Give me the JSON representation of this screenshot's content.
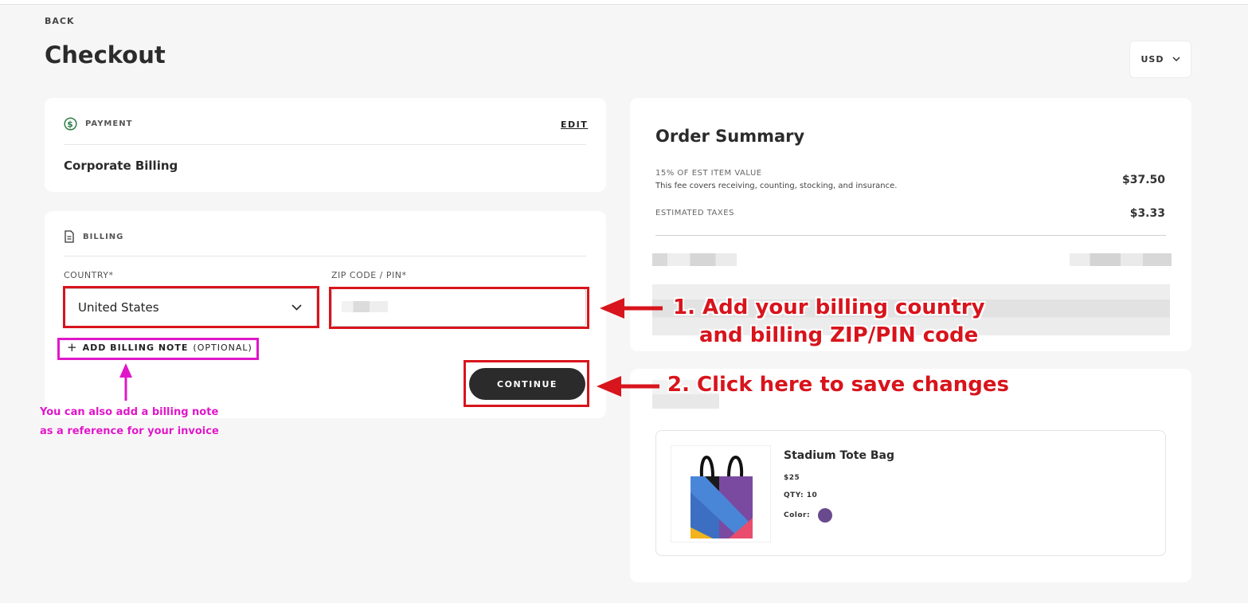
{
  "header": {
    "back_label": "BACK",
    "page_title": "Checkout",
    "currency": "USD"
  },
  "payment": {
    "section_label": "PAYMENT",
    "edit_label": "EDIT",
    "method": "Corporate Billing"
  },
  "billing": {
    "section_label": "BILLING",
    "country_label": "COUNTRY*",
    "country_value": "United States",
    "zip_label": "ZIP CODE / PIN*",
    "add_note_label": "ADD BILLING NOTE",
    "add_note_optional": "(OPTIONAL)",
    "continue_label": "CONTINUE"
  },
  "summary": {
    "title": "Order Summary",
    "fee_label": "15% OF EST ITEM VALUE",
    "fee_desc": "This fee covers receiving, counting, stocking, and insurance.",
    "fee_value": "$37.50",
    "tax_label": "ESTIMATED TAXES",
    "tax_value": "$3.33"
  },
  "item": {
    "name": "Stadium Tote Bag",
    "price": "$25",
    "qty": "QTY: 10",
    "color_label": "Color:",
    "color_hex": "#6a4a8e"
  },
  "annotations": {
    "step1_line1": "1. Add your billing country",
    "step1_line2": "and billing ZIP/PIN code",
    "step2": "2. Click here to save changes",
    "note_line1": "You can also add a billing note",
    "note_line2": "as a reference for your invoice"
  },
  "colors": {
    "annotation_red": "#d8141c",
    "annotation_magenta": "#e017c8",
    "button_dark": "#2b2b2b"
  }
}
